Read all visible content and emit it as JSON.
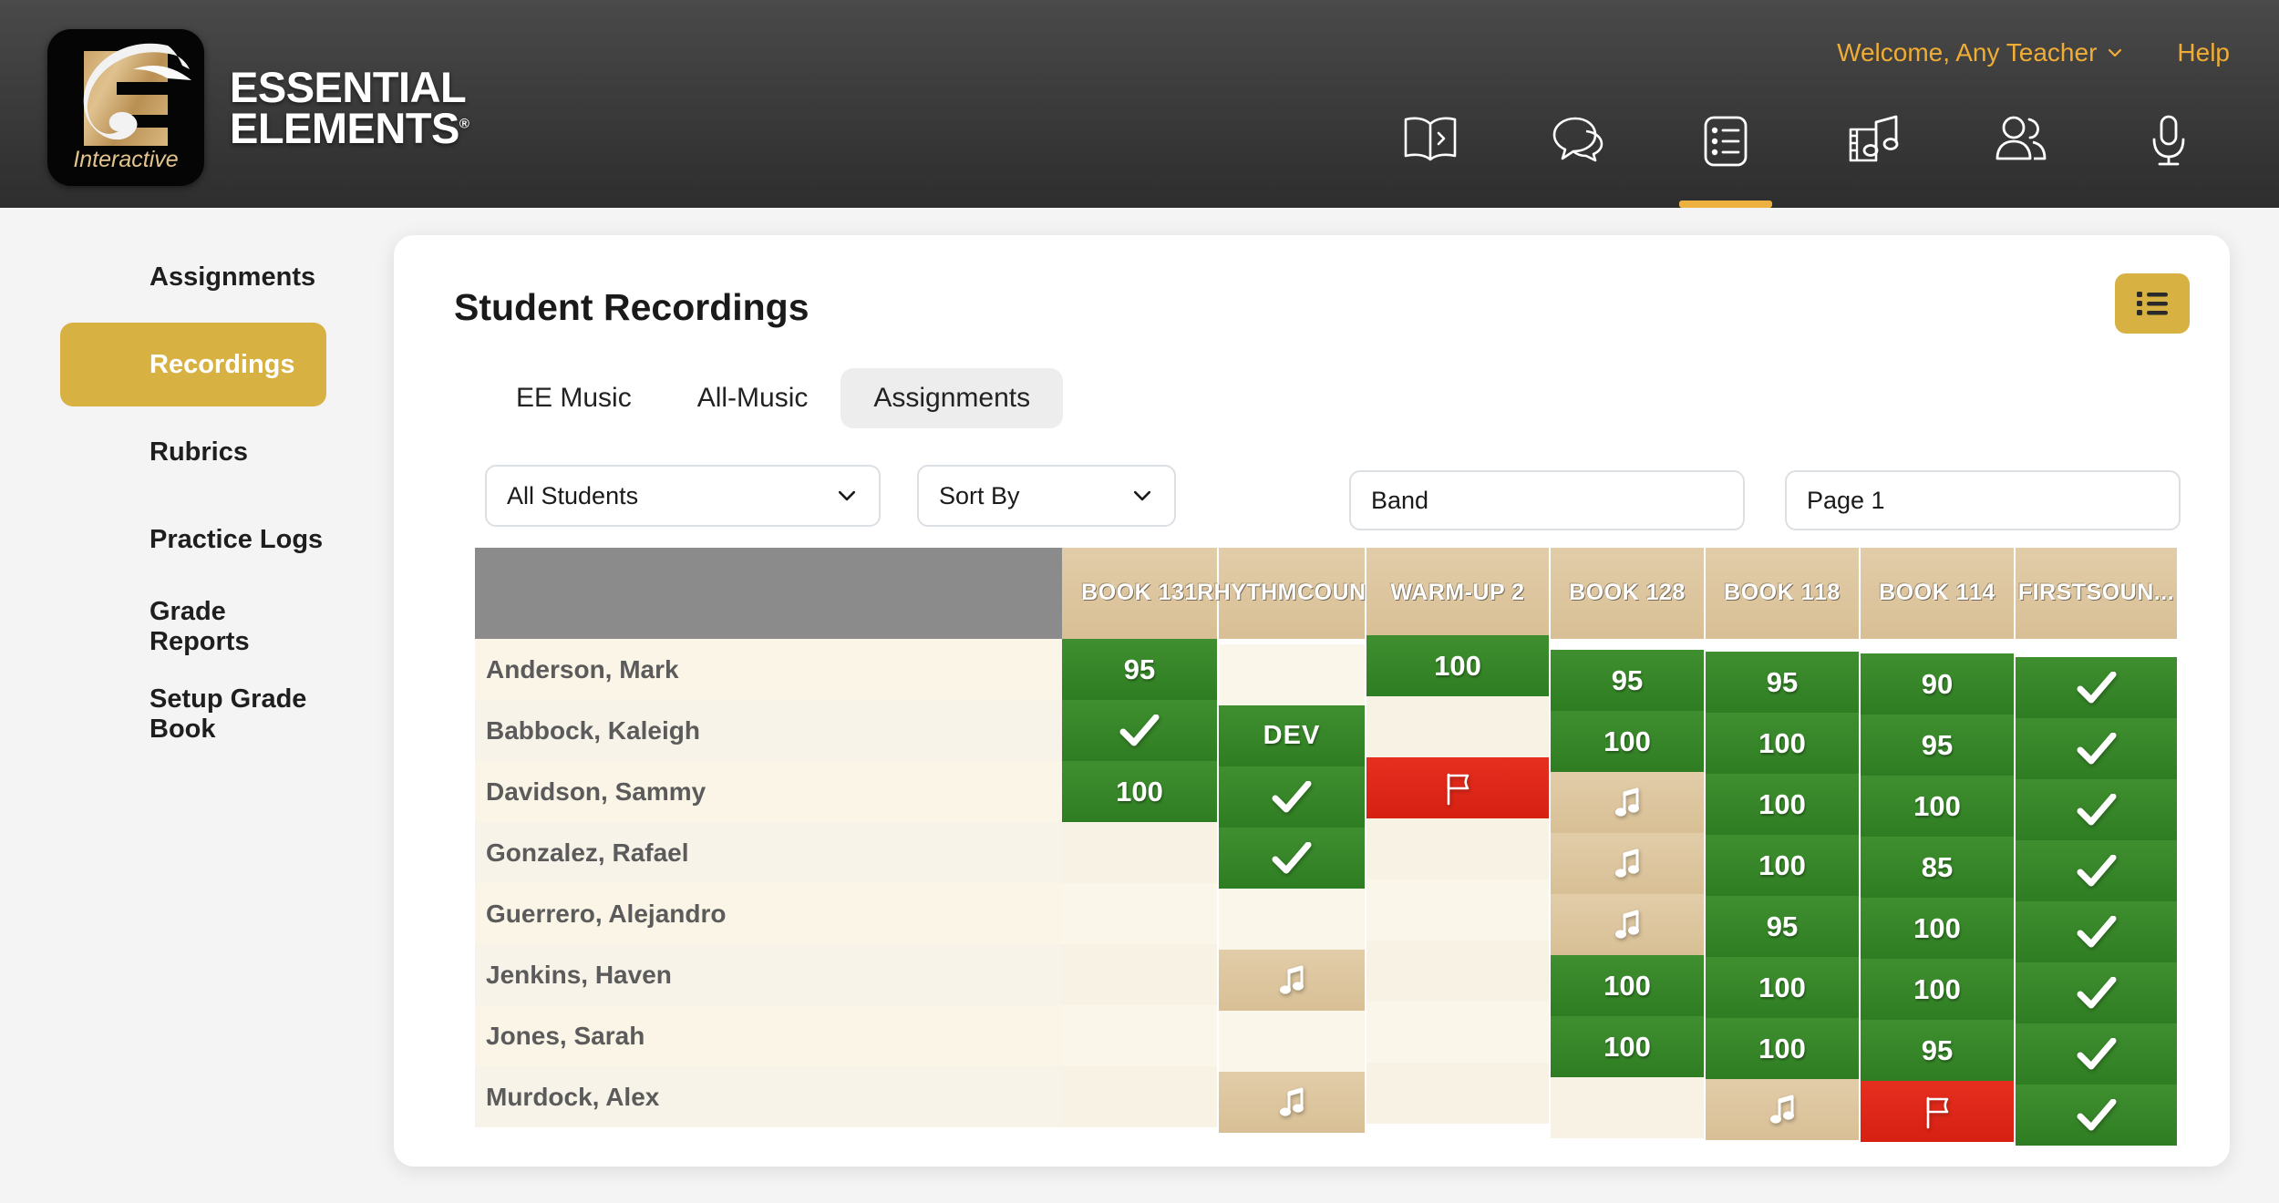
{
  "brand": {
    "logo_word1": "ESSENTIAL",
    "logo_word2": "ELEMENTS",
    "logo_tm": "®",
    "logo_sub": "Interactive"
  },
  "header": {
    "welcome": "Welcome, Any Teacher",
    "help": "Help",
    "nav_icons": [
      {
        "name": "book-open-icon",
        "label": "Book"
      },
      {
        "name": "chat-bubbles-icon",
        "label": "Messages"
      },
      {
        "name": "list-icon",
        "label": "Assignments",
        "active": true
      },
      {
        "name": "sheet-music-icon",
        "label": "Music"
      },
      {
        "name": "people-icon",
        "label": "Students"
      },
      {
        "name": "microphone-icon",
        "label": "Recordings"
      }
    ]
  },
  "sidebar": {
    "items": [
      {
        "label": "Assignments",
        "active": false
      },
      {
        "label": "Recordings",
        "active": true
      },
      {
        "label": "Rubrics",
        "active": false
      },
      {
        "label": "Practice Logs",
        "active": false
      },
      {
        "label": "Grade Reports",
        "active": false
      },
      {
        "label": "Setup Grade Book",
        "active": false
      }
    ]
  },
  "main": {
    "title": "Student Recordings",
    "list_toggle_icon": "list-icon",
    "tabs": [
      {
        "label": "EE Music",
        "active": false
      },
      {
        "label": "All-Music",
        "active": false
      },
      {
        "label": "Assignments",
        "active": true
      }
    ],
    "filters": {
      "students": "All Students",
      "sort": "Sort By",
      "band": "Band",
      "page": "Page 1"
    }
  },
  "chart_data": {
    "type": "table",
    "title": "Student Recordings",
    "row_header_label": "",
    "columns": [
      "BOOK 1\n31",
      "RHYTHM\nCOUN...",
      "WARM-UP 2",
      "BOOK 1\n28",
      "BOOK 1\n18",
      "BOOK 1\n14",
      "FIRST\nSOUN..."
    ],
    "rows": [
      {
        "student": "Anderson, Mark",
        "cells": [
          {
            "kind": "score",
            "value": "95"
          },
          {
            "kind": "empty",
            "value": ""
          },
          {
            "kind": "score",
            "value": "100"
          },
          {
            "kind": "score",
            "value": "95"
          },
          {
            "kind": "score",
            "value": "95"
          },
          {
            "kind": "score",
            "value": "90"
          },
          {
            "kind": "check",
            "value": ""
          }
        ]
      },
      {
        "student": "Babbock, Kaleigh",
        "cells": [
          {
            "kind": "check",
            "value": ""
          },
          {
            "kind": "dev",
            "value": "DEV"
          },
          {
            "kind": "empty",
            "value": ""
          },
          {
            "kind": "score",
            "value": "100"
          },
          {
            "kind": "score",
            "value": "100"
          },
          {
            "kind": "score",
            "value": "95"
          },
          {
            "kind": "check",
            "value": ""
          }
        ]
      },
      {
        "student": "Davidson, Sammy",
        "cells": [
          {
            "kind": "score",
            "value": "100"
          },
          {
            "kind": "check",
            "value": ""
          },
          {
            "kind": "flag",
            "value": ""
          },
          {
            "kind": "music",
            "value": ""
          },
          {
            "kind": "score",
            "value": "100"
          },
          {
            "kind": "score",
            "value": "100"
          },
          {
            "kind": "check",
            "value": ""
          }
        ]
      },
      {
        "student": "Gonzalez, Rafael",
        "cells": [
          {
            "kind": "empty",
            "value": ""
          },
          {
            "kind": "check",
            "value": ""
          },
          {
            "kind": "empty",
            "value": ""
          },
          {
            "kind": "music",
            "value": ""
          },
          {
            "kind": "score",
            "value": "100"
          },
          {
            "kind": "score",
            "value": "85"
          },
          {
            "kind": "check",
            "value": ""
          }
        ]
      },
      {
        "student": "Guerrero, Alejandro",
        "cells": [
          {
            "kind": "empty",
            "value": ""
          },
          {
            "kind": "empty",
            "value": ""
          },
          {
            "kind": "empty",
            "value": ""
          },
          {
            "kind": "music",
            "value": ""
          },
          {
            "kind": "score",
            "value": "95"
          },
          {
            "kind": "score",
            "value": "100"
          },
          {
            "kind": "check",
            "value": ""
          }
        ]
      },
      {
        "student": "Jenkins, Haven",
        "cells": [
          {
            "kind": "empty",
            "value": ""
          },
          {
            "kind": "music",
            "value": ""
          },
          {
            "kind": "empty",
            "value": ""
          },
          {
            "kind": "score",
            "value": "100"
          },
          {
            "kind": "score",
            "value": "100"
          },
          {
            "kind": "score",
            "value": "100"
          },
          {
            "kind": "check",
            "value": ""
          }
        ]
      },
      {
        "student": "Jones, Sarah",
        "cells": [
          {
            "kind": "empty",
            "value": ""
          },
          {
            "kind": "empty",
            "value": ""
          },
          {
            "kind": "empty",
            "value": ""
          },
          {
            "kind": "score",
            "value": "100"
          },
          {
            "kind": "score",
            "value": "100"
          },
          {
            "kind": "score",
            "value": "95"
          },
          {
            "kind": "check",
            "value": ""
          }
        ]
      },
      {
        "student": "Murdock, Alex",
        "cells": [
          {
            "kind": "empty",
            "value": ""
          },
          {
            "kind": "music",
            "value": ""
          },
          {
            "kind": "empty",
            "value": ""
          },
          {
            "kind": "empty",
            "value": ""
          },
          {
            "kind": "music",
            "value": ""
          },
          {
            "kind": "flag",
            "value": ""
          },
          {
            "kind": "check",
            "value": ""
          }
        ]
      }
    ]
  },
  "colors": {
    "brand_gold": "#d8b143",
    "header_gold_text": "#f0ad35",
    "score_green": "#2f7d22",
    "flag_red": "#d62012",
    "music_tan": "#d8bf95",
    "row_cream": "#fbf5e7"
  }
}
